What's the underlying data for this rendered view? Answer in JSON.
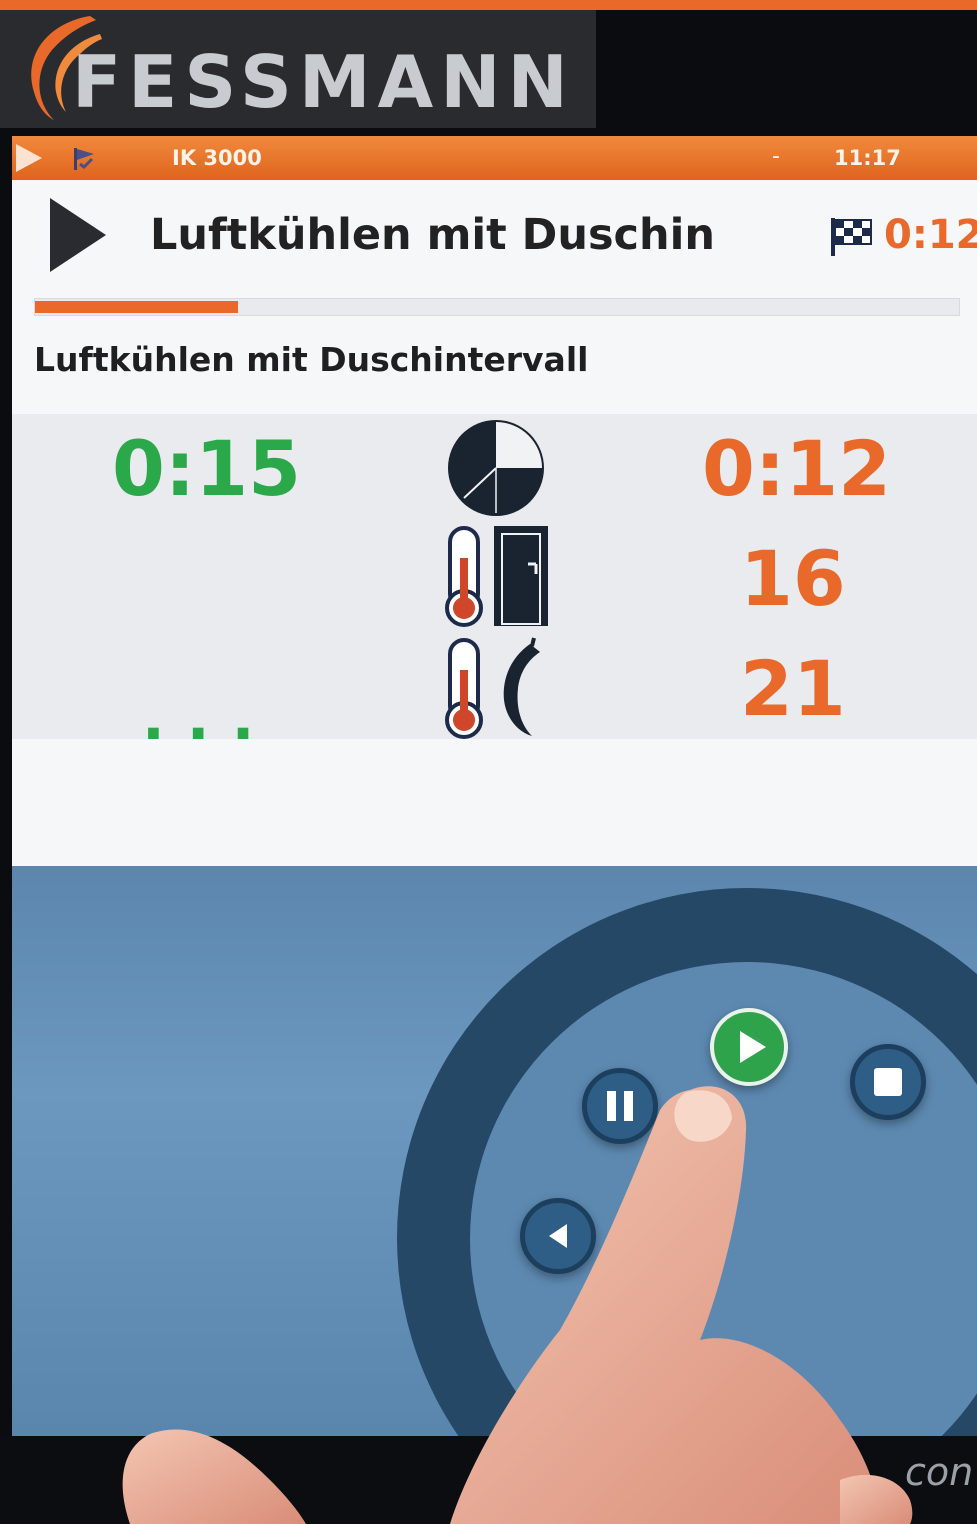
{
  "brand": {
    "name": "FESSMANN"
  },
  "statusbar": {
    "device": "IK 3000",
    "separator": "-",
    "clock": "11:17"
  },
  "header": {
    "program_name": "Luftkühlen mit Duschin",
    "finish_time": "0:12"
  },
  "progress": {
    "fraction": 0.22
  },
  "step": {
    "name": "Luftkühlen mit Duschintervall",
    "step_time": "0:15",
    "more_indicator": "..."
  },
  "values": {
    "remaining_time": "0:12",
    "room_temperature": "16",
    "core_temperature": "21"
  },
  "controls": {
    "start_icon": "play-icon",
    "stop_icon": "stop-icon",
    "pause_icon": "pause-icon",
    "back_icon": "rewind-icon"
  },
  "bezel": {
    "logo_fragment": "con"
  },
  "colors": {
    "accent": "#e8692a",
    "green": "#2aa84a",
    "control_blue": "#2e5d86"
  }
}
